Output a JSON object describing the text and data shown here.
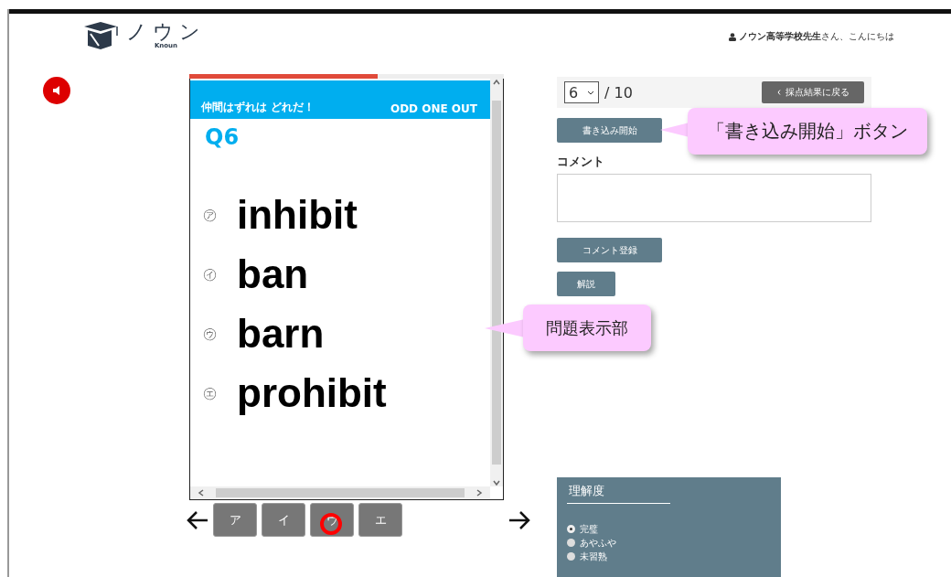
{
  "header": {
    "logo_text": "ノウン",
    "logo_subtext": "Knoun",
    "greeting_name": "ノウン高等学校先生",
    "greeting_suffix": "さん、こんにちは"
  },
  "progress": {
    "level": 0.6
  },
  "quiz": {
    "title_ja": "仲間はずれは どれだ！",
    "title_en": "ODD  ONE  OUT",
    "number": "Q6",
    "options": [
      {
        "mark": "㋐",
        "word": "inhibit"
      },
      {
        "mark": "㋑",
        "word": "ban"
      },
      {
        "mark": "㋒",
        "word": "barn"
      },
      {
        "mark": "㋓",
        "word": "prohibit"
      }
    ]
  },
  "answers": [
    {
      "label": "ア",
      "circled": false
    },
    {
      "label": "イ",
      "circled": false
    },
    {
      "label": "ウ",
      "circled": true
    },
    {
      "label": "エ",
      "circled": false
    }
  ],
  "pager": {
    "current": "6",
    "total": "/ 10",
    "back_button": "採点結果に戻る"
  },
  "write_button": "書き込み開始",
  "comment": {
    "label": "コメント",
    "submit_button": "コメント登録"
  },
  "explain_button": "解説",
  "understanding": {
    "title": "理解度",
    "options": [
      {
        "label": "完璧",
        "checked": true
      },
      {
        "label": "あやふや",
        "checked": false
      },
      {
        "label": "未習熟",
        "checked": false
      }
    ]
  },
  "callouts": [
    {
      "text": "「書き込み開始」ボタン"
    },
    {
      "text": "問題表示部"
    }
  ]
}
